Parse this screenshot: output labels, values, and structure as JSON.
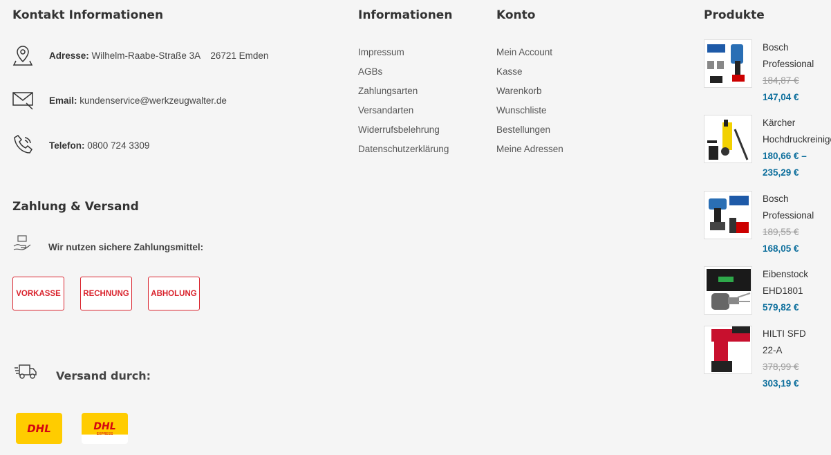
{
  "contact": {
    "title": "Kontakt Informationen",
    "address_label": "Adresse:",
    "address_value": "Wilhelm-Raabe-Straße 3A    26721 Emden",
    "email_label": "Email:",
    "email_value": "kundenservice@werkzeugwalter.de",
    "phone_label": "Telefon:",
    "phone_value": "0800 724 3309"
  },
  "payment": {
    "title": "Zahlung & Versand",
    "secure_text": "Wir nutzen sichere Zahlungsmittel:",
    "methods": [
      "VORKASSE",
      "RECHNUNG",
      "ABHOLUNG"
    ],
    "shipping_title": "Versand durch:",
    "carriers": [
      "DHL",
      "DHL"
    ],
    "carrier_sub": "EXPRESS"
  },
  "informationen": {
    "title": "Informationen",
    "links": [
      "Impressum",
      "AGBs",
      "Zahlungsarten",
      "Versandarten",
      "Widerrufsbelehrung",
      "Datenschutzerklärung"
    ]
  },
  "konto": {
    "title": "Konto",
    "links": [
      "Mein Account",
      "Kasse",
      "Warenkorb",
      "Wunschliste",
      "Bestellungen",
      "Meine Adressen"
    ]
  },
  "produkte": {
    "title": "Produkte",
    "items": [
      {
        "name1": "Bosch",
        "name2": "Professional",
        "old": "184,87 €",
        "price": "147,04 €"
      },
      {
        "name1": "Kärcher",
        "name2": "Hochdruckreiniger",
        "price": "180,66 € –",
        "price2": "235,29 €"
      },
      {
        "name1": "Bosch",
        "name2": "Professional",
        "old": "189,55 €",
        "price": "168,05 €"
      },
      {
        "name1": "Eibenstock",
        "name2": "EHD1801",
        "price": "579,82 €"
      },
      {
        "name1": "HILTI SFD",
        "name2": "22-A",
        "old": "378,99 €",
        "price": "303,19 €"
      }
    ]
  },
  "colors": {
    "accent_red": "#d9232d",
    "price_blue": "#0c6e9c",
    "dhl_yellow": "#ffcc00"
  }
}
